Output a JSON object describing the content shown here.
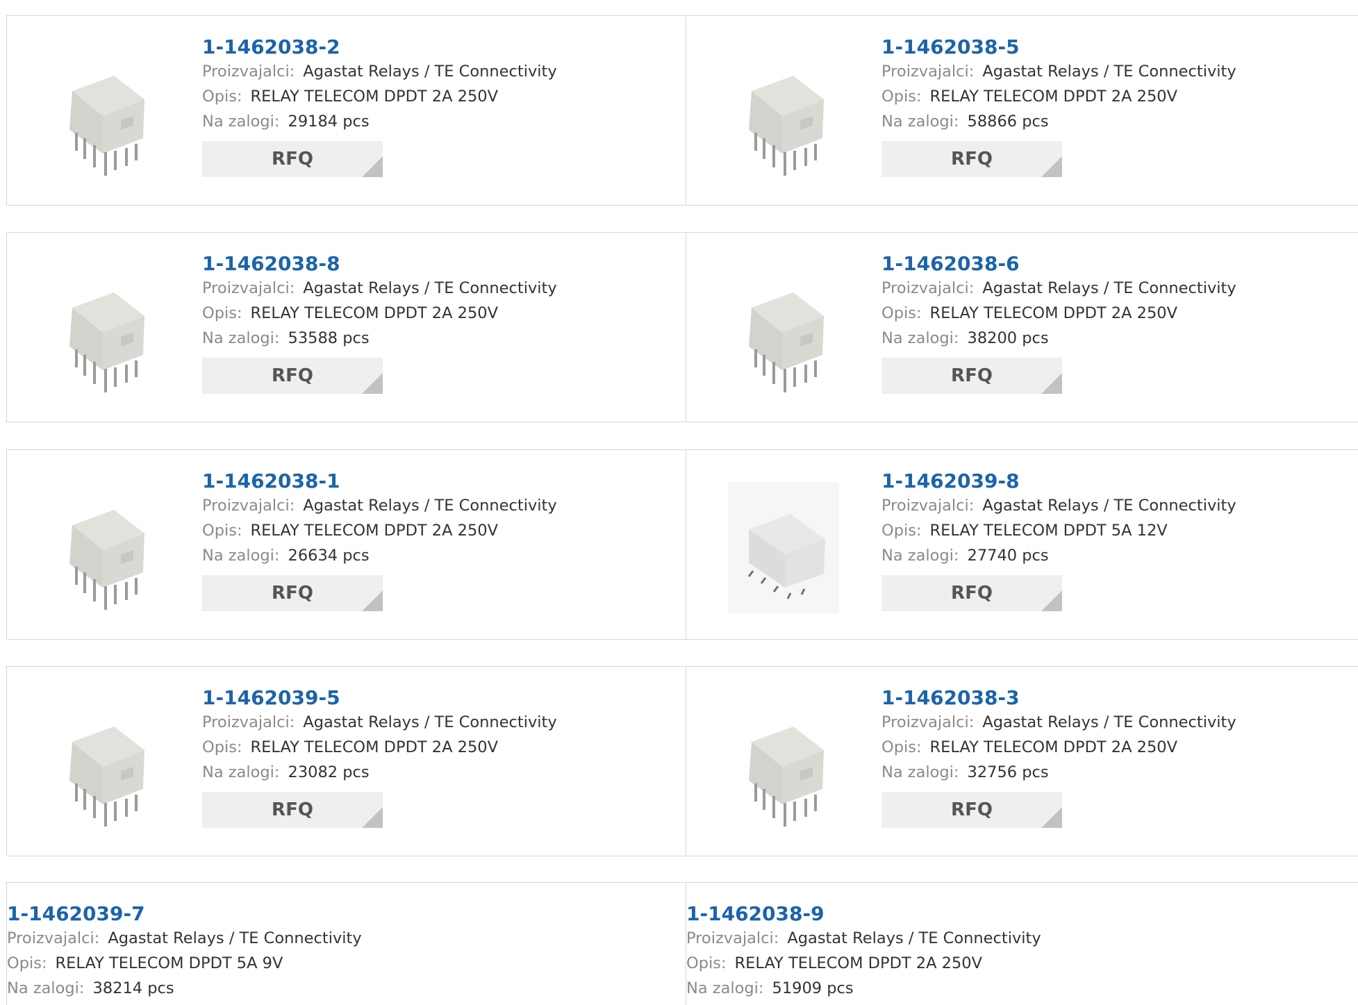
{
  "labels": {
    "manufacturer": "Proizvajalci:",
    "description": "Opis:",
    "stock": "Na zalogi:",
    "rfq": "RFQ"
  },
  "colors": {
    "link": "#1c64aa",
    "label": "#8a8a8a",
    "button_bg": "#efefef"
  },
  "products": [
    {
      "part": "1-1462038-2",
      "manufacturer": "Agastat Relays / TE Connectivity",
      "description": "RELAY TELECOM DPDT 2A 250V",
      "stock": "29184 pcs",
      "image": "relay-image"
    },
    {
      "part": "1-1462038-5",
      "manufacturer": "Agastat Relays / TE Connectivity",
      "description": "RELAY TELECOM DPDT 2A 250V",
      "stock": "58866 pcs",
      "image": "relay-image"
    },
    {
      "part": "1-1462038-8",
      "manufacturer": "Agastat Relays / TE Connectivity",
      "description": "RELAY TELECOM DPDT 2A 250V",
      "stock": "53588 pcs",
      "image": "relay-image"
    },
    {
      "part": "1-1462038-6",
      "manufacturer": "Agastat Relays / TE Connectivity",
      "description": "RELAY TELECOM DPDT 2A 250V",
      "stock": "38200 pcs",
      "image": "relay-image"
    },
    {
      "part": "1-1462038-1",
      "manufacturer": "Agastat Relays / TE Connectivity",
      "description": "RELAY TELECOM DPDT 2A 250V",
      "stock": "26634 pcs",
      "image": "relay-image"
    },
    {
      "part": "1-1462039-8",
      "manufacturer": "Agastat Relays / TE Connectivity",
      "description": "RELAY TELECOM DPDT 5A 12V",
      "stock": "27740 pcs",
      "image": "relay-smd-image"
    },
    {
      "part": "1-1462039-5",
      "manufacturer": "Agastat Relays / TE Connectivity",
      "description": "RELAY TELECOM DPDT 2A 250V",
      "stock": "23082 pcs",
      "image": "relay-image"
    },
    {
      "part": "1-1462038-3",
      "manufacturer": "Agastat Relays / TE Connectivity",
      "description": "RELAY TELECOM DPDT 2A 250V",
      "stock": "32756 pcs",
      "image": "relay-image"
    },
    {
      "part": "1-1462039-7",
      "manufacturer": "Agastat Relays / TE Connectivity",
      "description": "RELAY TELECOM DPDT 5A 9V",
      "stock": "38214 pcs"
    },
    {
      "part": "1-1462038-9",
      "manufacturer": "Agastat Relays / TE Connectivity",
      "description": "RELAY TELECOM DPDT 2A 250V",
      "stock": "51909 pcs"
    }
  ]
}
